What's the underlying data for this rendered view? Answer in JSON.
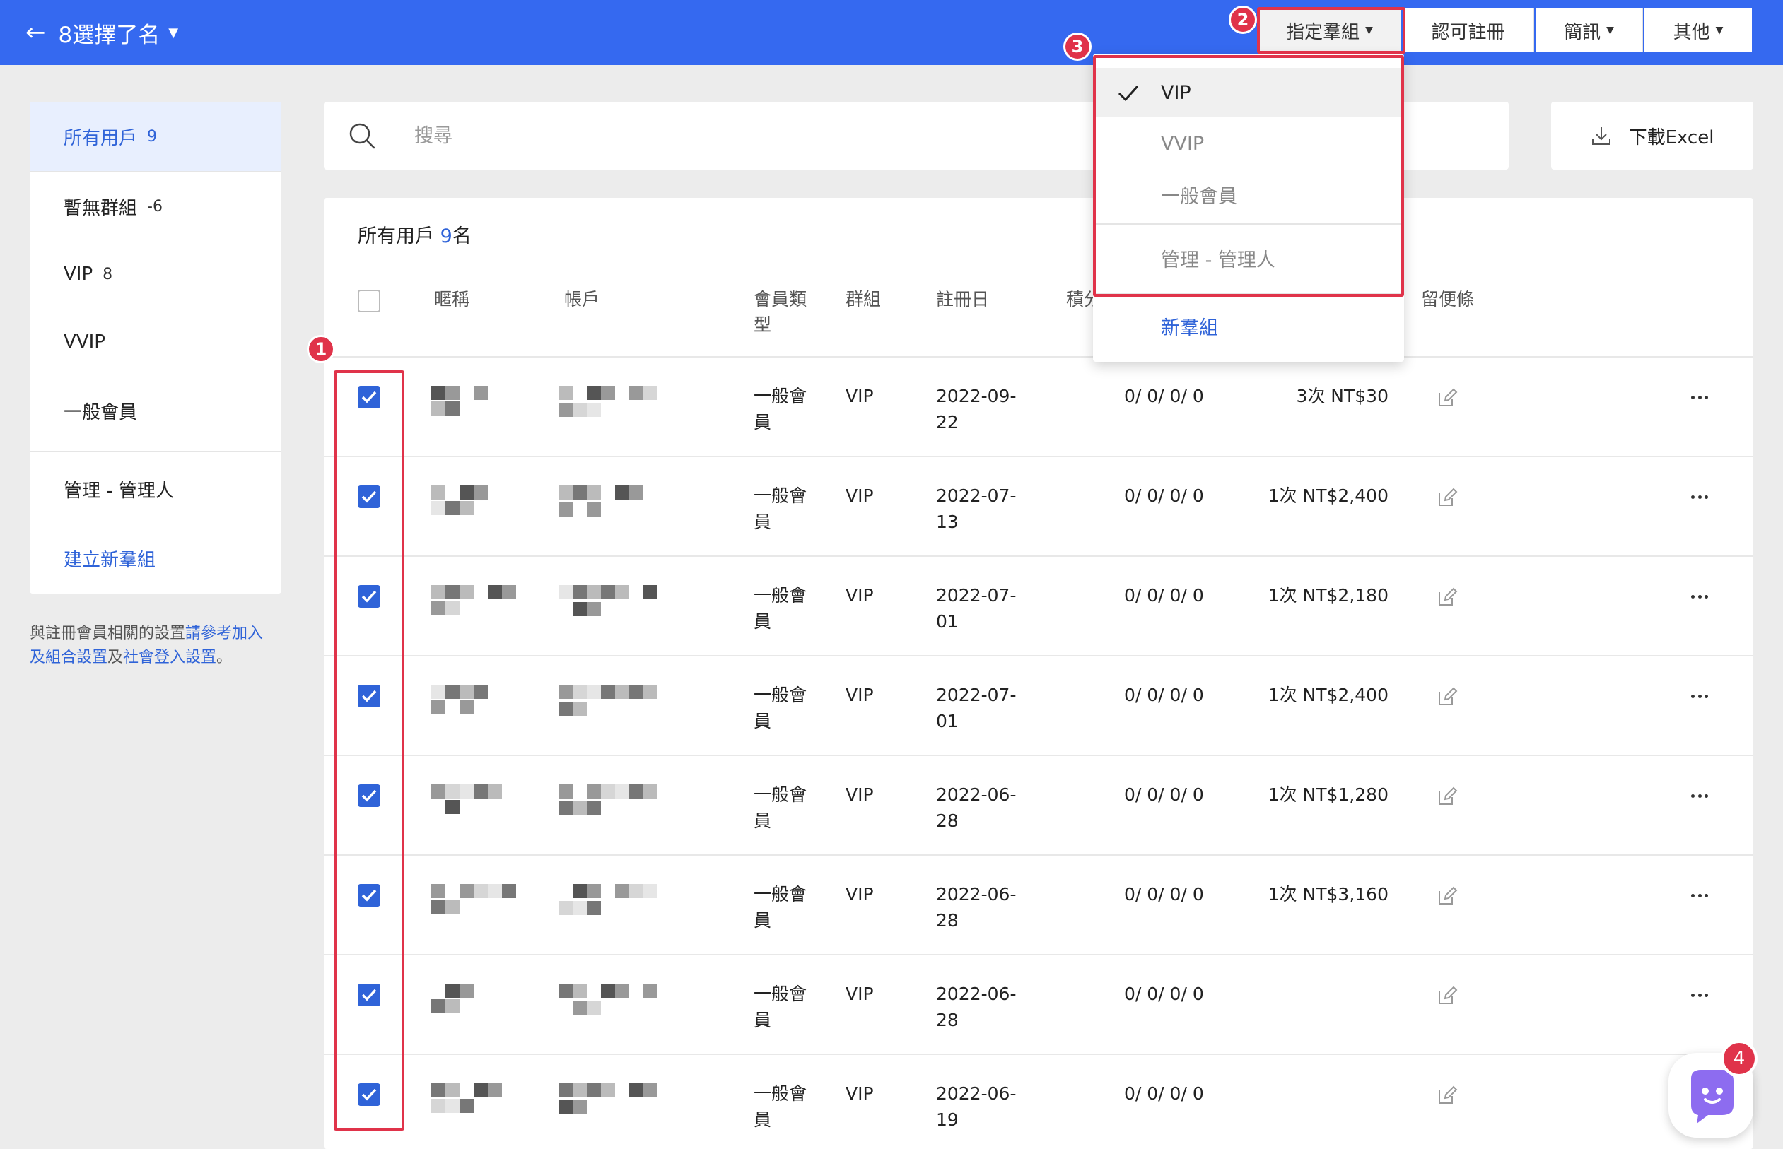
{
  "header": {
    "selection_label": "8選擇了名",
    "buttons": [
      "指定羣組",
      "認可註冊",
      "簡訊",
      "其他"
    ]
  },
  "sidebar": {
    "items": [
      {
        "label": "所有用戶",
        "count": "9"
      },
      {
        "label": "暫無群組",
        "count": "-6"
      },
      {
        "label": "VIP",
        "count": "8"
      },
      {
        "label": "VVIP",
        "count": ""
      },
      {
        "label": "一般會員",
        "count": ""
      },
      {
        "label": "管理 - 管理人",
        "count": ""
      }
    ],
    "create_label": "建立新羣組",
    "note": {
      "pre": "與註冊會員相關的設置",
      "link1": "請參考加入及組合設置",
      "mid": "及",
      "link2": "社會登入設置",
      "post": "。"
    }
  },
  "search": {
    "placeholder": "搜尋"
  },
  "download": {
    "label": "下載Excel"
  },
  "list": {
    "title_prefix": "所有用戶 ",
    "title_count": "9",
    "title_suffix": "名",
    "columns": [
      "暱稱",
      "帳戶",
      "會員類型",
      "群組",
      "註冊日",
      "積分",
      "留便條"
    ],
    "rows": [
      {
        "type": "一般會員",
        "group": "VIP",
        "date": "2022-09-22",
        "points": "0/ 0/ 0/ 0",
        "purchases": "3次 NT$30",
        "checked": true
      },
      {
        "type": "一般會員",
        "group": "VIP",
        "date": "2022-07-13",
        "points": "0/ 0/ 0/ 0",
        "purchases": "1次 NT$2,400",
        "checked": true
      },
      {
        "type": "一般會員",
        "group": "VIP",
        "date": "2022-07-01",
        "points": "0/ 0/ 0/ 0",
        "purchases": "1次 NT$2,180",
        "checked": true
      },
      {
        "type": "一般會員",
        "group": "VIP",
        "date": "2022-07-01",
        "points": "0/ 0/ 0/ 0",
        "purchases": "1次 NT$2,400",
        "checked": true
      },
      {
        "type": "一般會員",
        "group": "VIP",
        "date": "2022-06-28",
        "points": "0/ 0/ 0/ 0",
        "purchases": "1次 NT$1,280",
        "checked": true
      },
      {
        "type": "一般會員",
        "group": "VIP",
        "date": "2022-06-28",
        "points": "0/ 0/ 0/ 0",
        "purchases": "1次 NT$3,160",
        "checked": true
      },
      {
        "type": "一般會員",
        "group": "VIP",
        "date": "2022-06-28",
        "points": "0/ 0/ 0/ 0",
        "purchases": "",
        "checked": true
      },
      {
        "type": "一般會員",
        "group": "VIP",
        "date": "2022-06-19",
        "points": "0/ 0/ 0/ 0",
        "purchases": "",
        "checked": true
      }
    ]
  },
  "dropdown": {
    "items": [
      "VIP",
      "VVIP",
      "一般會員",
      "管理 - 管理人"
    ],
    "selected": "VIP",
    "new_group_label": "新羣組"
  },
  "annotations": {
    "badges": [
      "1",
      "2",
      "3"
    ],
    "color": "#e0334a"
  },
  "chat": {
    "badge_count": "4"
  },
  "colors": {
    "primary": "#3569f0",
    "link": "#2f63d8",
    "accent_red": "#e0334a"
  }
}
